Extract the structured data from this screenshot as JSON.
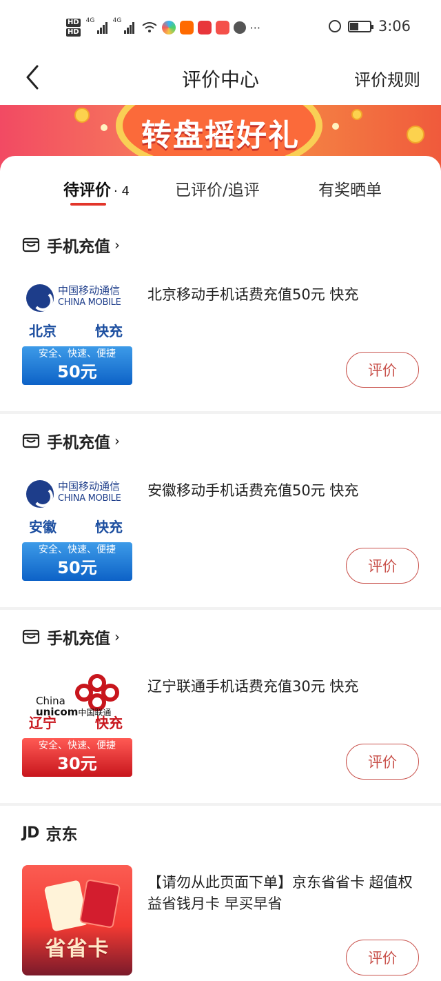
{
  "status_bar": {
    "hd1": "HD",
    "hd2": "HD",
    "net1": "4G",
    "net2": "4G",
    "more": "···",
    "time": "3:06"
  },
  "header": {
    "title": "评价中心",
    "rules": "评价规则"
  },
  "banner": {
    "text": "转盘摇好礼"
  },
  "tabs": [
    {
      "label": "待评价",
      "count": "· 4"
    },
    {
      "label": "已评价/追评"
    },
    {
      "label": "有奖晒单"
    }
  ],
  "orders": [
    {
      "shop": "手机充值",
      "product": "北京移动手机话费充值50元 快充",
      "thumb": {
        "carrier_cn": "中国移动通信",
        "carrier_en": "CHINA MOBILE",
        "region": "北京",
        "speed": "快充",
        "slogan": "安全、快速、便捷",
        "price": "50元"
      },
      "button": "评价"
    },
    {
      "shop": "手机充值",
      "product": "安徽移动手机话费充值50元 快充",
      "thumb": {
        "carrier_cn": "中国移动通信",
        "carrier_en": "CHINA MOBILE",
        "region": "安徽",
        "speed": "快充",
        "slogan": "安全、快速、便捷",
        "price": "50元"
      },
      "button": "评价"
    },
    {
      "shop": "手机充值",
      "product": "辽宁联通手机话费充值30元 快充",
      "thumb": {
        "carrier_en1": "China",
        "carrier_en2": "unicom",
        "carrier_cn": "中国联通",
        "region": "辽宁",
        "speed": "快充",
        "slogan": "安全、快速、便捷",
        "price": "30元"
      },
      "button": "评价"
    },
    {
      "shop": "京东",
      "shop_logo": "JD",
      "product": "【请勿从此页面下单】京东省省卡 超值权益省钱月卡 早买早省",
      "thumb": {
        "label": "省省卡"
      },
      "button": "评价"
    }
  ],
  "icons": {
    "back": "chevron-left-icon",
    "shop": "store-icon",
    "chevron": "chevron-right-icon"
  },
  "colors": {
    "accent": "#e2352a",
    "button_border": "#c8504a",
    "mobile_blue": "#1d3d8a",
    "unicom_red": "#c8161d"
  }
}
